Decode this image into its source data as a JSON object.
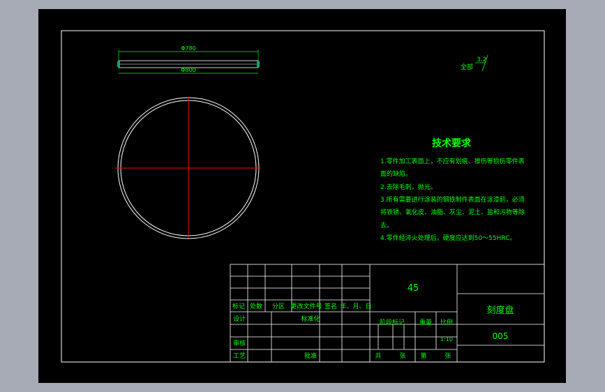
{
  "colors": {
    "background": "#a6abb6",
    "sheet": "#000000",
    "line": "#ffffff",
    "text": "#00ff00",
    "center_line": "#ff0000",
    "dim_line": "#00ff00"
  },
  "dimensions": {
    "outer_diameter": "Φ780",
    "inner_diameter": "Φ800"
  },
  "surface_finish": {
    "label": "全部",
    "value": "3.2"
  },
  "tech_requirements": {
    "title": "技术要求",
    "lines": [
      "1.零件加工表面上，不应有划痕、擦伤等损伤零件表",
      "面的缺陷。",
      "2.去除毛刺，抛光。",
      "3.所有需要进行涂装的钢铁制件表面在涂漆前，必须",
      "将铁锈、氧化皮、油脂、灰尘、泥土、盐和污物等除",
      "去。",
      "4.零件经淬火处理后，硬度应达到50～55HRC。"
    ]
  },
  "title_block": {
    "material": "45",
    "part_name": "刻度盘",
    "drawing_no": "005",
    "row_labels": [
      "标记",
      "处数",
      "分区",
      "更改文件号",
      "签名",
      "年、月、日"
    ],
    "design": "设计",
    "standardize": "标准化",
    "review": "审核",
    "process": "工艺",
    "approve": "批准",
    "stage_mark": "阶段标记",
    "weight": "重量",
    "scale": "比例",
    "scale_value": "1:10",
    "sheets_total": "共",
    "sheets_unit": "张",
    "sheet_no": "第",
    "sheet_unit2": "张"
  }
}
